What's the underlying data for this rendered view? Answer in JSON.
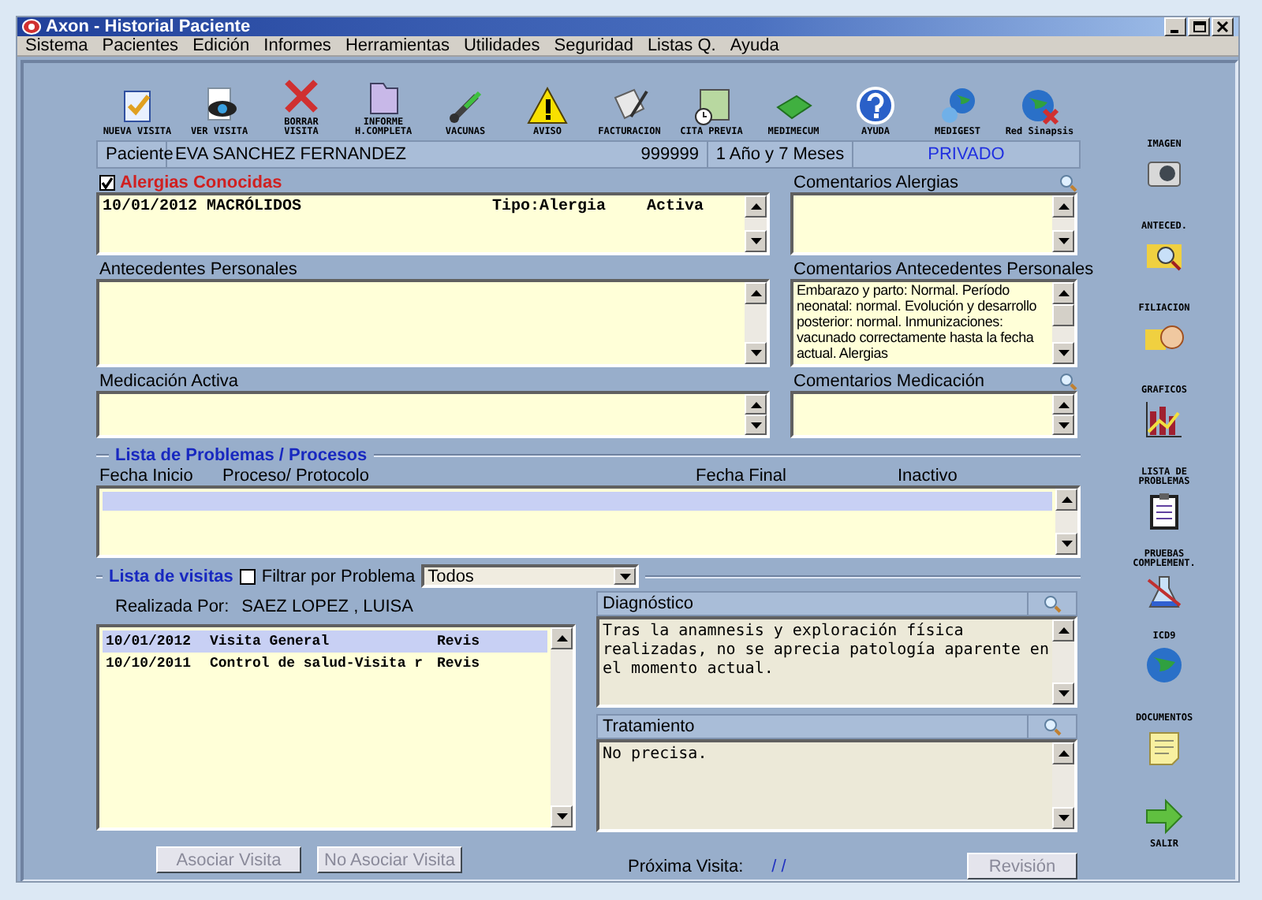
{
  "window": {
    "title": "Axon - Historial Paciente"
  },
  "menu": [
    "Sistema",
    "Pacientes",
    "Edición",
    "Informes",
    "Herramientas",
    "Utilidades",
    "Seguridad",
    "Listas Q.",
    "Ayuda"
  ],
  "toolbar": [
    {
      "label": "NUEVA VISITA"
    },
    {
      "label": "VER VISITA"
    },
    {
      "label": "BORRAR VISITA"
    },
    {
      "label": "INFORME H.COMPLETA"
    },
    {
      "label": "VACUNAS"
    },
    {
      "label": "AVISO"
    },
    {
      "label": "FACTURACION"
    },
    {
      "label": "CITA PREVIA"
    },
    {
      "label": "MEDIMECUM"
    },
    {
      "label": "AYUDA"
    },
    {
      "label": "MEDIGEST"
    },
    {
      "label": "Red Sinapsis"
    }
  ],
  "patient": {
    "label": "Paciente",
    "name": "EVA SANCHEZ FERNANDEZ",
    "number": "999999",
    "age": "1 Año y 7 Meses",
    "insurance": "PRIVADO"
  },
  "allergies": {
    "label": "Alergias Conocidas",
    "checked": true,
    "rows": [
      {
        "date": "10/01/2012",
        "name": "MACRÓLIDOS",
        "type": "Tipo:Alergia",
        "status": "Activa"
      }
    ]
  },
  "allergy_comments": {
    "label": "Comentarios Alergias"
  },
  "history": {
    "label": "Antecedentes Personales"
  },
  "history_comments": {
    "label": "Comentarios Antecedentes Personales",
    "text": "Embarazo y parto: Normal. Período neonatal: normal. Evolución y desarrollo posterior: normal. Inmunizaciones: vacunado correctamente hasta la fecha actual. Alergias"
  },
  "medication": {
    "label": "Medicación Activa"
  },
  "medication_comments": {
    "label": "Comentarios Medicación"
  },
  "problems": {
    "title": "Lista de Problemas / Procesos",
    "columns": [
      "Fecha Inicio",
      "Proceso/ Protocolo",
      "Fecha Final",
      "Inactivo"
    ],
    "rows": [
      {
        "selected": true
      }
    ]
  },
  "visits": {
    "title": "Lista de visitas",
    "filter": {
      "label": "Filtrar por Problema",
      "checked": false
    },
    "dropdown": "Todos",
    "by_label": "Realizada Por:",
    "by": "SAEZ LOPEZ , LUISA",
    "rows": [
      {
        "date": "10/01/2012",
        "name": "Visita General",
        "type": "Revis",
        "selected": true
      },
      {
        "date": "10/10/2011",
        "name": "Control de salud-Visita r",
        "type": "Revis",
        "selected": false
      }
    ]
  },
  "diagnosis": {
    "label": "Diagnóstico",
    "text": "Tras la anamnesis y exploración física realizadas, no se aprecia patología aparente en el momento actual."
  },
  "treatment": {
    "label": "Tratamiento",
    "text": "No precisa."
  },
  "buttons": [
    {
      "label": "Asociar Visita",
      "disabled": true
    },
    {
      "label": "No Asociar Visita",
      "disabled": true
    }
  ],
  "next_visit": {
    "label": "Próxima Visita:",
    "value": "/ /"
  },
  "review_button": {
    "label": "Revisión",
    "disabled": true
  },
  "sidebar": [
    {
      "label": "IMAGEN"
    },
    {
      "label": "ANTECED."
    },
    {
      "label": "FILIACION"
    },
    {
      "label": "GRAFICOS"
    },
    {
      "label": "LISTA DE PROBLEMAS"
    },
    {
      "label": "PRUEBAS COMPLEMENT."
    },
    {
      "label": "ICD9"
    },
    {
      "label": "DOCUMENTOS"
    },
    {
      "label": "SALIR"
    }
  ]
}
